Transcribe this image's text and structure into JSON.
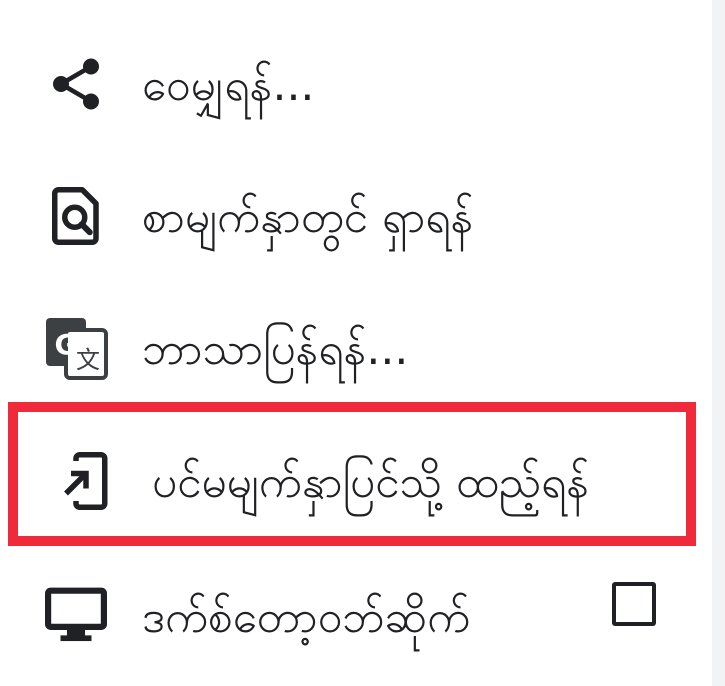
{
  "menu": {
    "items": [
      {
        "label": "ဝေမျှရန်...",
        "icon": "share-icon"
      },
      {
        "label": "စာမျက်နှာတွင် ရှာရန်",
        "icon": "find-in-page-icon"
      },
      {
        "label": "ဘာသာပြန်ရန်...",
        "icon": "translate-icon"
      },
      {
        "label": "ပင်မမျက်နှာပြင်သို့ ထည့်ရန်",
        "icon": "add-to-home-screen-icon"
      },
      {
        "label": "ဒက်စ်တော့ဝဘ်ဆိုက်",
        "icon": "desktop-icon"
      }
    ],
    "desktop_checkbox_checked": false
  },
  "colors": {
    "text": "#202124",
    "highlight": "#ef2b3b",
    "background": "#ffffff"
  }
}
